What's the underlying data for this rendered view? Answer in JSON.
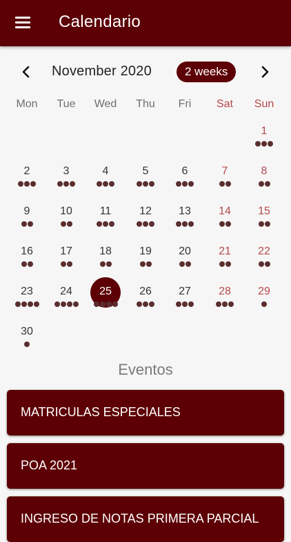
{
  "appbar": {
    "title": "Calendario",
    "menu_icon": "menu-icon"
  },
  "calendar": {
    "month_label": "November 2020",
    "view_toggle": "2 weeks",
    "prev_icon": "chevron-left-icon",
    "next_icon": "chevron-right-icon",
    "weekdays": [
      "Mon",
      "Tue",
      "Wed",
      "Thu",
      "Fri",
      "Sat",
      "Sun"
    ],
    "today": "25",
    "days": [
      {
        "day": "1",
        "dots": 3
      },
      {
        "day": "2",
        "dots": 3
      },
      {
        "day": "3",
        "dots": 3
      },
      {
        "day": "4",
        "dots": 3
      },
      {
        "day": "5",
        "dots": 3
      },
      {
        "day": "6",
        "dots": 3
      },
      {
        "day": "7",
        "dots": 2
      },
      {
        "day": "8",
        "dots": 2
      },
      {
        "day": "9",
        "dots": 2
      },
      {
        "day": "10",
        "dots": 2
      },
      {
        "day": "11",
        "dots": 3
      },
      {
        "day": "12",
        "dots": 3
      },
      {
        "day": "13",
        "dots": 3
      },
      {
        "day": "14",
        "dots": 2
      },
      {
        "day": "15",
        "dots": 2
      },
      {
        "day": "16",
        "dots": 2
      },
      {
        "day": "17",
        "dots": 2
      },
      {
        "day": "18",
        "dots": 2
      },
      {
        "day": "19",
        "dots": 2
      },
      {
        "day": "20",
        "dots": 2
      },
      {
        "day": "21",
        "dots": 2
      },
      {
        "day": "22",
        "dots": 2
      },
      {
        "day": "23",
        "dots": 4
      },
      {
        "day": "24",
        "dots": 4
      },
      {
        "day": "25",
        "dots": 4
      },
      {
        "day": "26",
        "dots": 3
      },
      {
        "day": "27",
        "dots": 3
      },
      {
        "day": "28",
        "dots": 3
      },
      {
        "day": "29",
        "dots": 1
      },
      {
        "day": "30",
        "dots": 1
      }
    ]
  },
  "events": {
    "title": "Eventos",
    "items": [
      {
        "label": "MATRICULAS ESPECIALES"
      },
      {
        "label": "POA 2021"
      },
      {
        "label": "INGRESO DE NOTAS PRIMERA PARCIAL"
      }
    ]
  },
  "colors": {
    "primary": "#5c0005",
    "weekend": "#b5484a",
    "dot": "#5a2e2e"
  }
}
